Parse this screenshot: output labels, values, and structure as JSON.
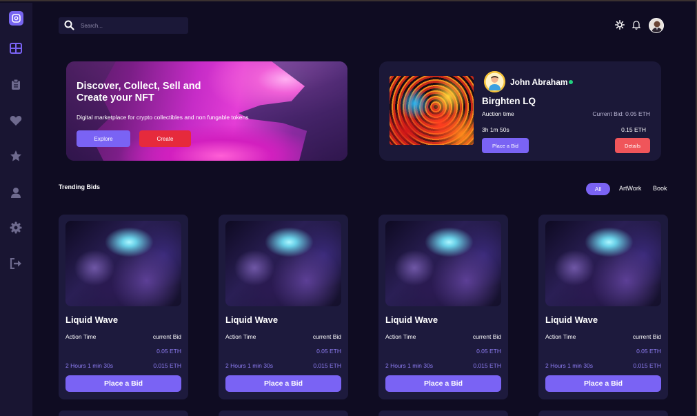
{
  "search": {
    "placeholder": "Search..."
  },
  "sidebar": {
    "items": [
      {
        "icon": "grid-icon",
        "active": true
      },
      {
        "icon": "clipboard-icon"
      },
      {
        "icon": "heart-icon"
      },
      {
        "icon": "star-icon"
      },
      {
        "icon": "user-icon"
      },
      {
        "icon": "gear-icon"
      },
      {
        "icon": "logout-icon"
      }
    ]
  },
  "hero": {
    "title": "Discover, Collect, Sell and Create your NFT",
    "subtitle": "Digital marketplace for crypto collectibles and non fungable tokens",
    "explore_label": "Explore",
    "create_label": "Create"
  },
  "featured": {
    "owner": "John Abraham",
    "title": "Birghten LQ",
    "auction_label": "Auction time",
    "bid_label": "Current Bid: 0.05 ETH",
    "time": "3h 1m 50s",
    "amount": "0.15 ETH",
    "place_bid_label": "Place a Bid",
    "details_label": "Details"
  },
  "trending": {
    "title": "Trending Bids",
    "filters": [
      "All",
      "ArtWork",
      "Book"
    ]
  },
  "cards": [
    {
      "title": "Liquid Wave",
      "time_label": "Action Time",
      "bid_label": "current Bid",
      "bid_value": "0.05 ETH",
      "time": "2 Hours 1 min 30s",
      "min_bid": "0.015 ETH",
      "button": "Place a Bid"
    },
    {
      "title": "Liquid Wave",
      "time_label": "Action Time",
      "bid_label": "current Bid",
      "bid_value": "0.05 ETH",
      "time": "2 Hours 1 min 30s",
      "min_bid": "0.015 ETH",
      "button": "Place a Bid"
    },
    {
      "title": "Liquid Wave",
      "time_label": "Action Time",
      "bid_label": "current Bid",
      "bid_value": "0.05 ETH",
      "time": "2 Hours 1 min 30s",
      "min_bid": "0.015 ETH",
      "button": "Place a Bid"
    },
    {
      "title": "Liquid Wave",
      "time_label": "Action Time",
      "bid_label": "current Bid",
      "bid_value": "0.05 ETH",
      "time": "2 Hours 1 min 30s",
      "min_bid": "0.015 ETH",
      "button": "Place a Bid"
    }
  ],
  "colors": {
    "accent": "#7a63f4",
    "danger": "#e62a3c",
    "background": "#0f0c22",
    "card": "#1d1a3d",
    "online": "#22d07f"
  }
}
